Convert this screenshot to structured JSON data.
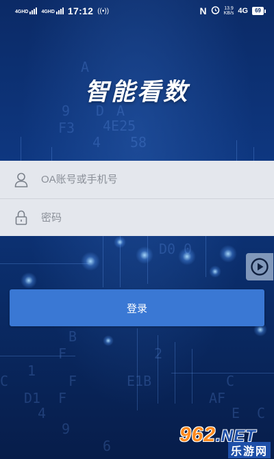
{
  "status_bar": {
    "signal_1": "4GHD",
    "signal_2": "4GHD",
    "time": "17:12",
    "net_speed_value": "13.9",
    "net_speed_unit": "KB/s",
    "network": "4G",
    "battery": "69",
    "icons": [
      "nfc-icon",
      "alarm-icon",
      "hotspot-icon"
    ]
  },
  "app": {
    "title": "智能看数"
  },
  "login_form": {
    "account_placeholder": "OA账号或手机号",
    "password_placeholder": "密码",
    "submit_label": "登录"
  },
  "watermark": {
    "main": "962",
    "suffix": ".NET",
    "sub": "乐游网"
  },
  "colors": {
    "background": "#0e3780",
    "form_panel": "#e4e7ed",
    "button": "#3a78d4"
  }
}
